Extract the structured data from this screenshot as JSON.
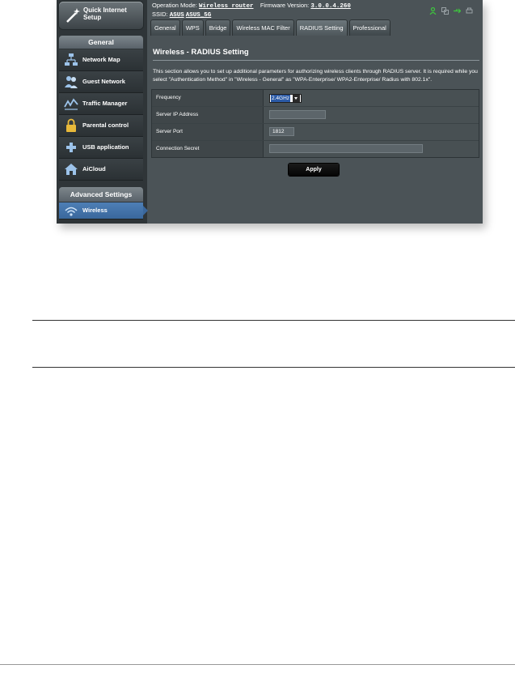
{
  "sidebar": {
    "qis_label": "Quick Internet Setup",
    "general_header": "General",
    "items": [
      {
        "label": "Network Map",
        "icon": "network-map-icon"
      },
      {
        "label": "Guest Network",
        "icon": "guest-network-icon"
      },
      {
        "label": "Traffic Manager",
        "icon": "traffic-manager-icon"
      },
      {
        "label": "Parental control",
        "icon": "parental-control-icon"
      },
      {
        "label": "USB application",
        "icon": "usb-application-icon"
      },
      {
        "label": "AiCloud",
        "icon": "aicloud-icon"
      }
    ],
    "advanced_header": "Advanced Settings",
    "wireless_label": "Wireless"
  },
  "header": {
    "op_mode_label": "Operation Mode:",
    "op_mode_value": "Wireless router",
    "fw_label": "Firmware Version:",
    "fw_value": "3.0.0.4.260",
    "ssid_label": "SSID:",
    "ssid_1": "ASUS",
    "ssid_2": "ASUS_5G"
  },
  "tabs": [
    "General",
    "WPS",
    "Bridge",
    "Wireless MAC Filter",
    "RADIUS Setting",
    "Professional"
  ],
  "active_tab": "RADIUS Setting",
  "panel": {
    "title": "Wireless - RADIUS Setting",
    "description": "This section allows you to set up additional parameters for authorizing wireless clients through RADIUS server. It is required while you select \"Authentication Method\" in \"Wireless - General\" as \"WPA-Enterprise/ WPA2-Enterprise/ Radius with 802.1x\".",
    "fields": {
      "frequency_label": "Frequency",
      "frequency_value": "2.4GHz",
      "server_ip_label": "Server IP Address",
      "server_ip_value": "",
      "server_port_label": "Server Port",
      "server_port_value": "1812",
      "secret_label": "Connection Secret",
      "secret_value": ""
    },
    "apply_label": "Apply"
  },
  "colors": {
    "panel_bg": "#4b5357",
    "sidebar_bg": "#2f3538",
    "active_nav": "#3a679c",
    "status_green": "#3ec43e"
  }
}
